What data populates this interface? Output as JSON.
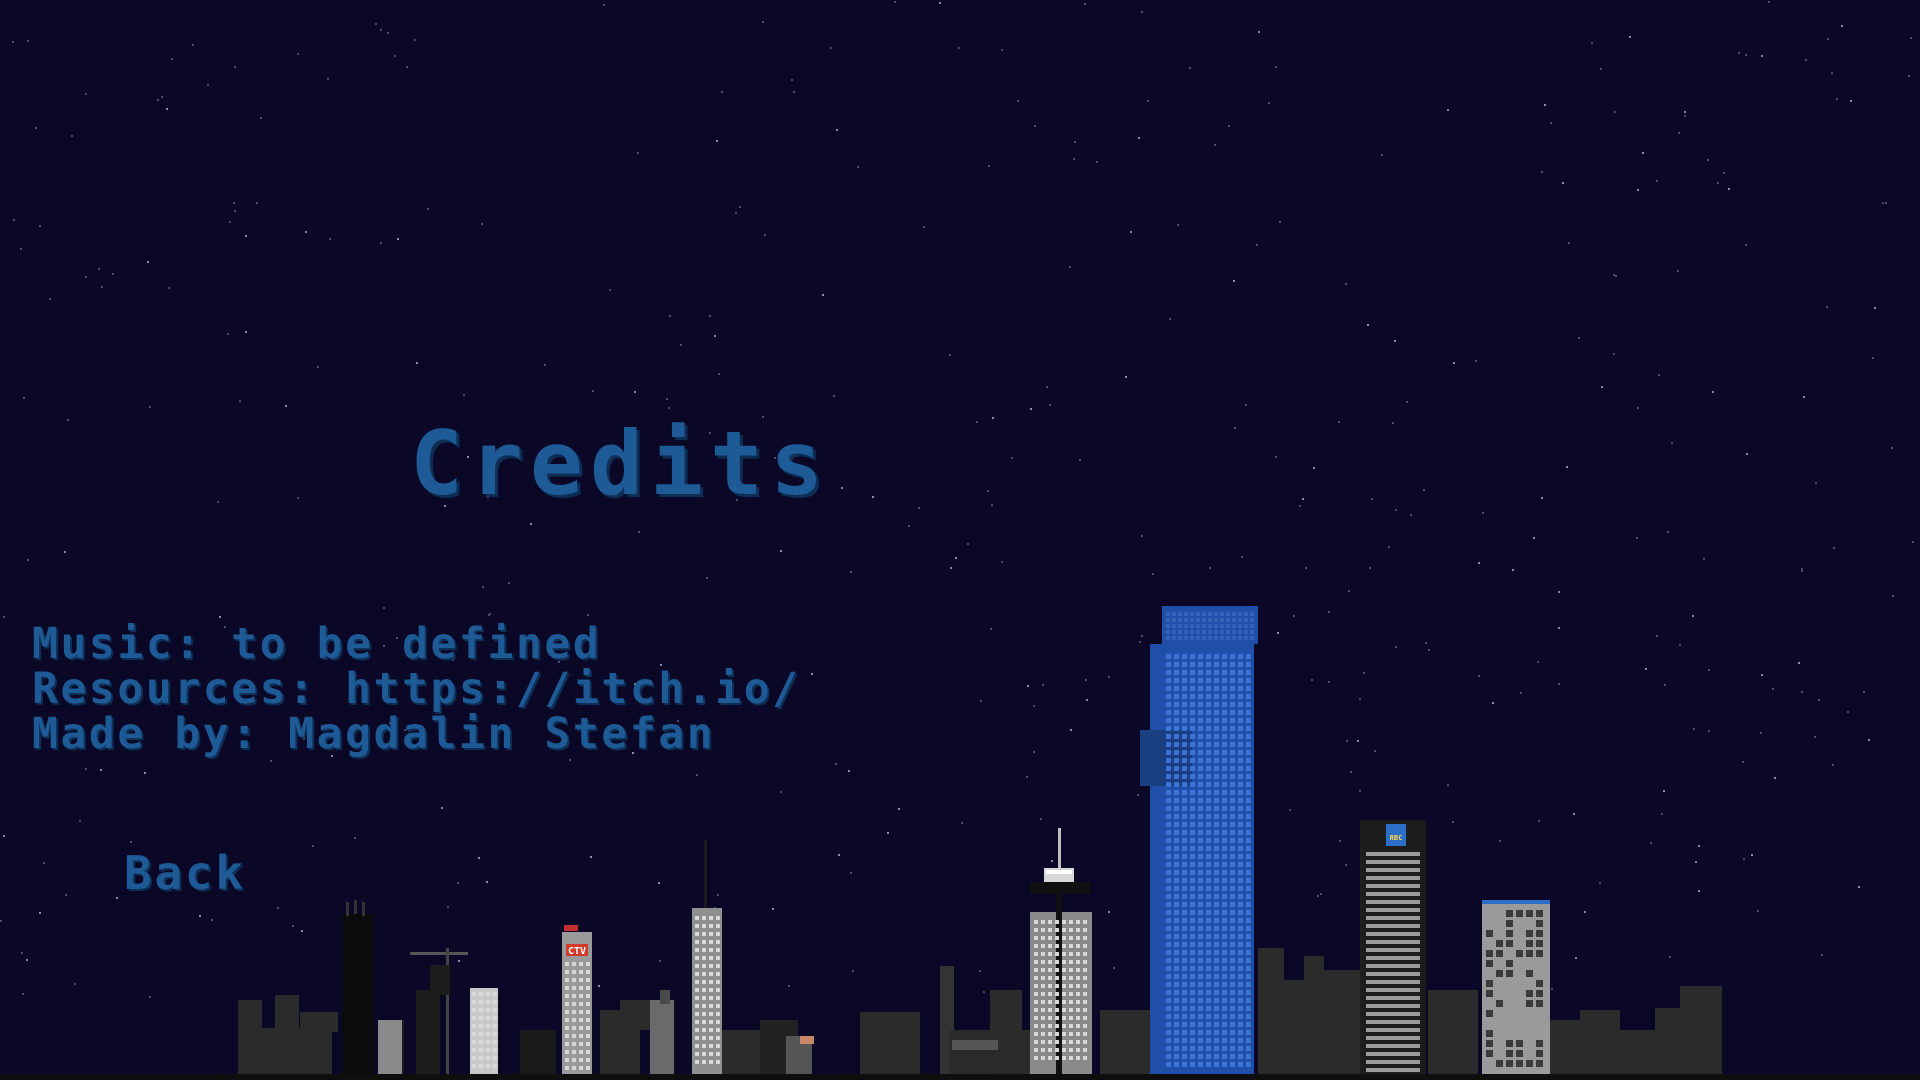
{
  "screen": {
    "title": "Credits",
    "credits": [
      {
        "label": "Music:",
        "value": "to be defined"
      },
      {
        "label": "Resources:",
        "value": "https://itch.io/"
      },
      {
        "label": "Made by:",
        "value": "Magdalin Stefan"
      }
    ],
    "back_label": "Back"
  },
  "signs": {
    "tv_sign": "CTV",
    "rbc_sign": "RBC"
  },
  "colors": {
    "sky": "#0a0826",
    "text": "#1e5a96",
    "tower_blue": "#1f4fa8",
    "building_gray": "#7a7a7a",
    "building_dark": "#2a2a2a"
  }
}
